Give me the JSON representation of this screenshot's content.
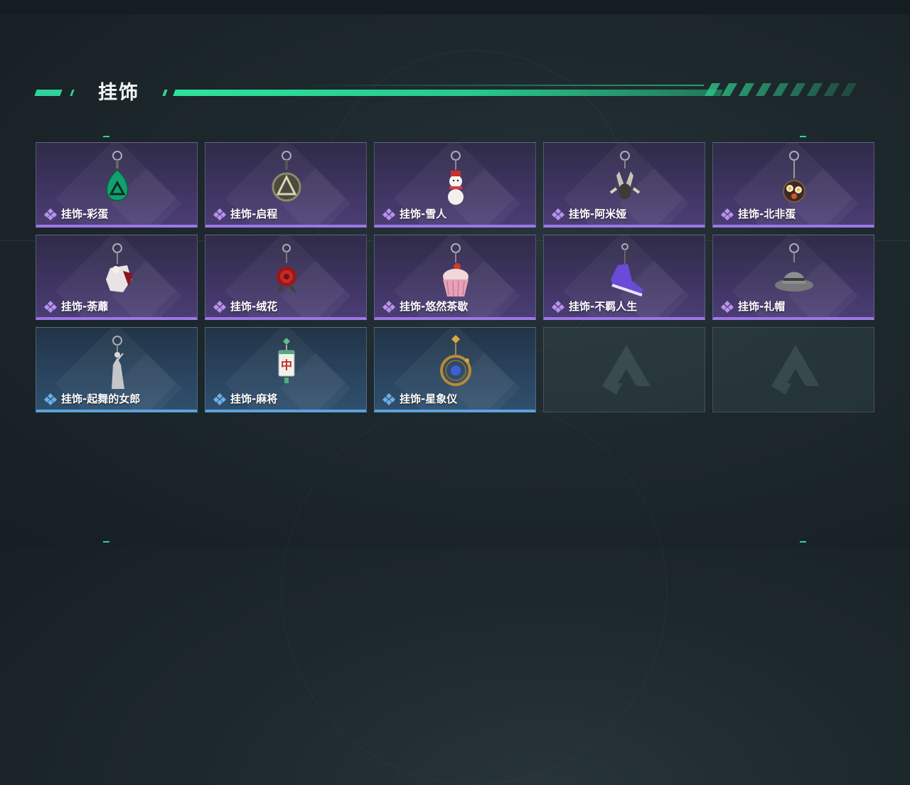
{
  "header": {
    "title": "挂饰"
  },
  "colors": {
    "accent": "#2fd39a",
    "rare_purple": "#9c77e6",
    "rare_blue": "#5aa2de"
  },
  "items": [
    {
      "label": "挂饰-彩蛋",
      "rarity": "purple",
      "icon": "green-egg-charm-icon"
    },
    {
      "label": "挂饰-启程",
      "rarity": "purple",
      "icon": "medallion-charm-icon"
    },
    {
      "label": "挂饰-雪人",
      "rarity": "purple",
      "icon": "snowman-charm-icon"
    },
    {
      "label": "挂饰-阿米娅",
      "rarity": "purple",
      "icon": "bunny-figure-charm-icon"
    },
    {
      "label": "挂饰-北非蛋",
      "rarity": "purple",
      "icon": "shakshuka-pan-charm-icon"
    },
    {
      "label": "挂饰-荼蘼",
      "rarity": "purple",
      "icon": "doll-charm-icon"
    },
    {
      "label": "挂饰-绒花",
      "rarity": "purple",
      "icon": "red-rose-charm-icon"
    },
    {
      "label": "挂饰-悠然茶歇",
      "rarity": "purple",
      "icon": "cupcake-charm-icon"
    },
    {
      "label": "挂饰-不羁人生",
      "rarity": "purple",
      "icon": "purple-sneaker-charm-icon"
    },
    {
      "label": "挂饰-礼帽",
      "rarity": "purple",
      "icon": "fedora-hat-charm-icon"
    },
    {
      "label": "挂饰-起舞的女郎",
      "rarity": "blue",
      "icon": "dancing-lady-charm-icon"
    },
    {
      "label": "挂饰-麻将",
      "rarity": "blue",
      "icon": "mahjong-tile-charm-icon"
    },
    {
      "label": "挂饰-星象仪",
      "rarity": "blue",
      "icon": "astrolabe-charm-icon"
    }
  ],
  "empty_slots": 2,
  "mahjong_glyph": "中"
}
